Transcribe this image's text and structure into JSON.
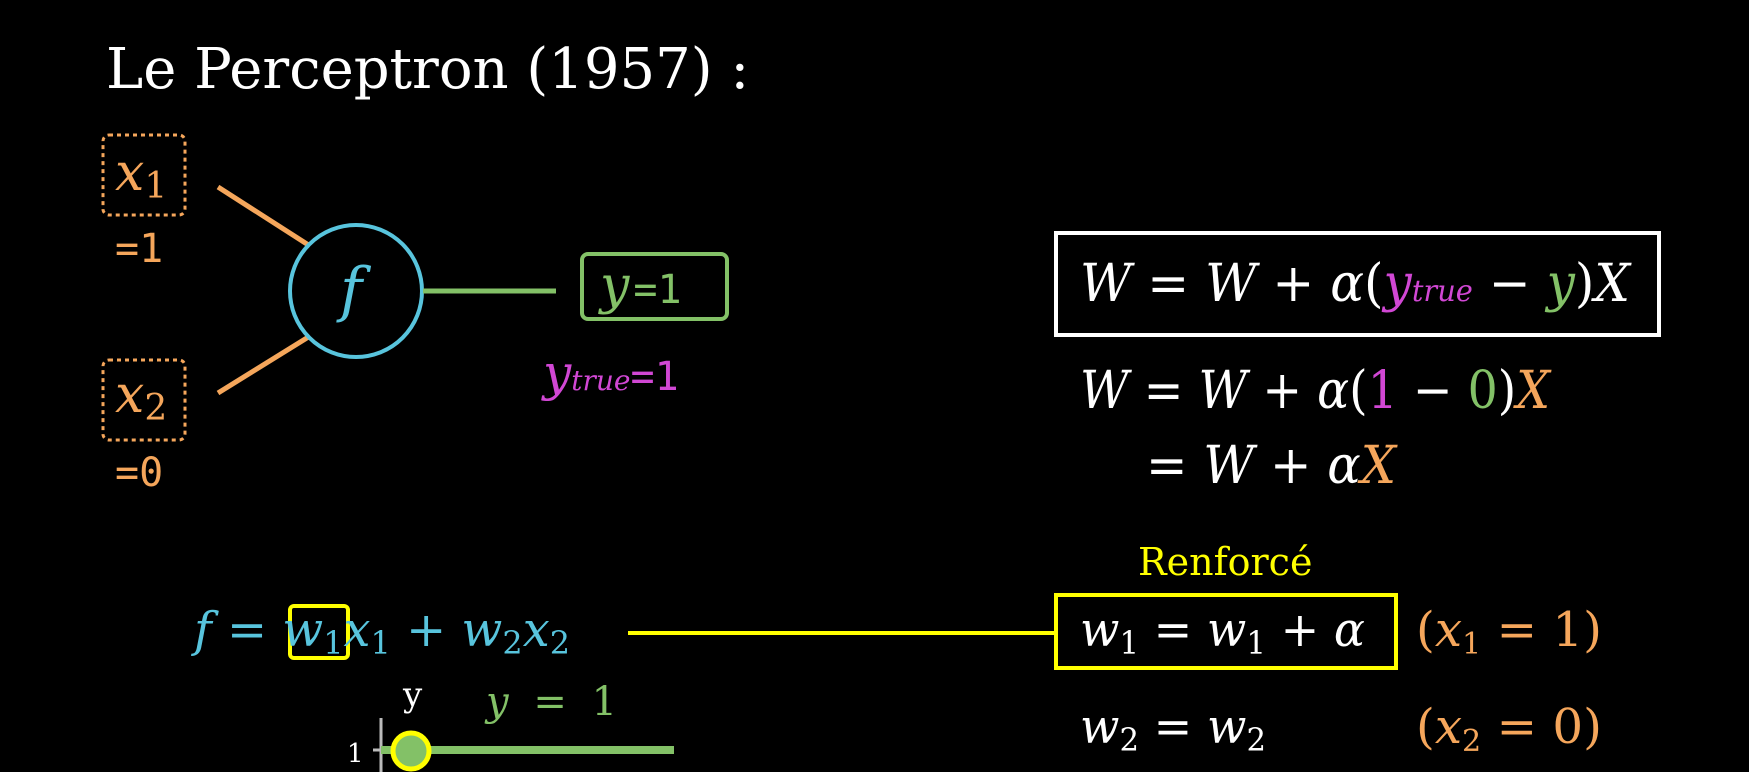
{
  "title": "Le Perceptron (1957) :",
  "colors": {
    "background": "#000000",
    "input": "#F5A65B",
    "neuron": "#58C4DD",
    "output": "#83C167",
    "target": "#D147D4",
    "highlight": "#FFFF00",
    "text": "#FFFFFF"
  },
  "network": {
    "inputs": [
      {
        "var": "x",
        "sub": "1",
        "value": "=1"
      },
      {
        "var": "x",
        "sub": "2",
        "value": "=0"
      }
    ],
    "neuron_label": "f",
    "output": {
      "var": "y",
      "value": "=1"
    },
    "target": {
      "var": "y",
      "sub": "true",
      "value": "=1"
    }
  },
  "update_rule": {
    "main": {
      "lhs": "W",
      "eq": "=",
      "w": "W",
      "plus": "+",
      "alpha": "α",
      "open": "(",
      "ytrue": "y",
      "ytrue_sub": "true",
      "minus": "−",
      "y": "y",
      "close": ")",
      "x": "X"
    },
    "step1": {
      "lhs": "W",
      "eq": "=",
      "w": "W",
      "plus": "+",
      "alpha": "α",
      "open": "(",
      "one": "1",
      "minus": "−",
      "zero": "0",
      "close": ")",
      "x": "X"
    },
    "step2": {
      "eq": "=",
      "w": "W",
      "plus": "+",
      "alpha": "α",
      "x": "X"
    }
  },
  "function_eq": {
    "f": "f",
    "eq": "=",
    "w1": "w",
    "w1_sub": "1",
    "x1": "x",
    "x1_sub": "1",
    "plus": "+",
    "w2": "w",
    "w2_sub": "2",
    "x2": "x",
    "x2_sub": "2"
  },
  "reinforced": {
    "label": "Renforcé",
    "w1_eq": {
      "lhs": "w",
      "lhs_sub": "1",
      "eq": "=",
      "rhs": "w",
      "rhs_sub": "1",
      "plus": "+",
      "alpha": "α"
    },
    "w1_cond": {
      "open": "(",
      "var": "x",
      "sub": "1",
      "eq": "=",
      "val": "1",
      "close": ")"
    },
    "w2_eq": {
      "lhs": "w",
      "lhs_sub": "2",
      "eq": "=",
      "rhs": "w",
      "rhs_sub": "2"
    },
    "w2_cond": {
      "open": "(",
      "var": "x",
      "sub": "2",
      "eq": "=",
      "val": "0",
      "close": ")"
    }
  },
  "mini_plot": {
    "y_axis_label": "y",
    "tick_label": "1",
    "line_label_var": "y",
    "line_label_eq": "=",
    "line_label_val": "1"
  }
}
